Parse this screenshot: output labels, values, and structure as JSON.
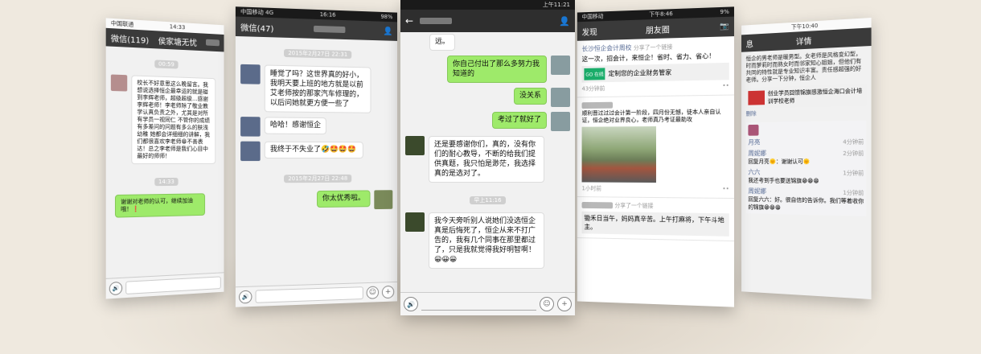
{
  "phone1": {
    "status": {
      "carrier": "中国联通",
      "time": "14:33"
    },
    "nav": {
      "back": "微信(119)",
      "title": "侯家塘无忧"
    },
    "time1": "00:59",
    "msg_in": "校长不好意思这么晚留言。我想说选择恒企最幸运的就是碰到李辉老师，超级超级…感谢李辉老师！李老师除了敬业教学认真负责之外，尤其是对所有学员一视同仁 不管你的成绩有多差问的问题有多么的肤浅幼稚 她都会详细细的讲解，我们都很喜欢李老师😁不善表达！总之李老师是我们心目中最好的师师！",
    "time2": "14:33",
    "msg_out": "谢谢对老师的认可，继续加油哦！❗"
  },
  "phone2": {
    "status": {
      "carrier": "中国移动",
      "network": "4G",
      "time": "16:16",
      "battery": "98%"
    },
    "nav": {
      "back": "微信(47)"
    },
    "time1": "2015年2月27日 22:31",
    "msg1": "睡觉了吗？这世界真的好小，我明天要上班的地方就是以前艾老师按的那家汽车修理的，以后问她就更方便一些了",
    "msg2": "哈哈！感谢恒企",
    "msg3": "我终于不失业了🤣🤩🤩🤩",
    "time2": "2015年2月27日 22:48",
    "msg4": "你太优秀啦。"
  },
  "phone3": {
    "status": {
      "time": "上午11:21"
    },
    "msg0": "远。",
    "msg1": "你自己付出了那么多努力我知道的",
    "msg2": "没关系",
    "msg3": "考过了就好了",
    "msg4": "还是要感谢你们，真的，没有你们的耐心教导，不断的给我们提供真题，我只怕是渺茫，我选择真的是选对了。",
    "time1": "早上11:16",
    "msg5": "我今天旁听别人说她们没选恒企真是后悔死了，恒企从来不打广告的，我有几个同事在那里都过了，只是我就觉得我好明智啊！😀😀😀"
  },
  "phone4": {
    "status": {
      "carrier": "中国移动",
      "time": "下午8:46",
      "battery": "9%"
    },
    "nav": {
      "back": "发现",
      "title": "朋友圈"
    },
    "post1": {
      "name": "长沙恒企会计周校",
      "shared": "分享了一个链接",
      "text": "这一次，招会计，来恒企！省时、省力、省心！",
      "link_title": "定制您的企业财务管家",
      "link_badge": "GO 在线",
      "time": "43分钟前"
    },
    "post2": {
      "text": "顺利晋过过过会计第一阶段，四月份无憾，徒本人亲自认证，恒企绝对业界良心，老师真乃考证最助攻",
      "time": "1小时前"
    },
    "post3": {
      "shared": "分享了一个链接",
      "text": "锄禾日当午，妈妈真辛苦。上午打麻将，下午斗地主。"
    }
  },
  "phone5": {
    "status": {
      "time": "下午10:40"
    },
    "nav": {
      "back": "息",
      "title": "详情"
    },
    "text": "恒企的男老师是暖男型。女老师是风格变幻型，时而萝莉时而熟女时而邻家知心姐姐，但他们有共同的特性就是专业知识丰富。责任感超强的好老师。分享一下分钟，恒企人",
    "link": "创业学员回馈锦旗感激恒企海口会计培训学校老师",
    "delete": "删除",
    "c1_name": "月亮",
    "c1_time": "4分钟前",
    "c2_name": "周妮娜",
    "c2_text": "回复月亮🌞：谢谢认可🌞",
    "c2_time": "2分钟前",
    "c3_name": "六六",
    "c3_text": "我还考到手也要送锦旗😁😁😁",
    "c3_time": "1分钟前",
    "c4_name": "周妮娜",
    "c4_text": "回复六六：好。很自信的告诉你。我们等着收你的锦旗😁😁😁",
    "c4_time": "1分钟前"
  },
  "icons": {
    "voice": "🔊",
    "emoji": "☺",
    "plus": "+",
    "camera": "📷",
    "back": "‹",
    "person": "👤"
  }
}
